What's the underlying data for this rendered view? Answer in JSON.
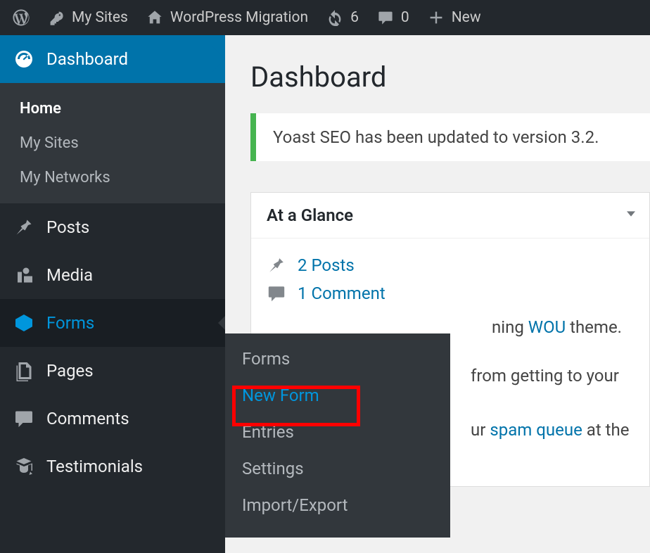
{
  "adminbar": {
    "my_sites": "My Sites",
    "site_title": "WordPress Migration",
    "updates_count": "6",
    "comments_count": "0",
    "new_label": "New"
  },
  "sidebar": {
    "dashboard": {
      "label": "Dashboard",
      "submenu": {
        "home": "Home",
        "my_sites": "My Sites",
        "my_networks": "My Networks"
      }
    },
    "posts": "Posts",
    "media": "Media",
    "forms": {
      "label": "Forms",
      "submenu": {
        "forms": "Forms",
        "new_form": "New Form",
        "entries": "Entries",
        "settings": "Settings",
        "import_export": "Import/Export"
      }
    },
    "pages": "Pages",
    "comments": "Comments",
    "testimonials": "Testimonials"
  },
  "content": {
    "title": "Dashboard",
    "notice": "Yoast SEO has been updated to version 3.2.",
    "glance": {
      "header": "At a Glance",
      "posts": "2 Posts",
      "comments": "1 Comment",
      "theme_prefix": "ning ",
      "theme_name": "WOU",
      "theme_suffix": " theme.",
      "spam_line1": " from getting to your bl",
      "spam_link": "spam queue",
      "spam_line2_prefix": "ur ",
      "spam_line2_suffix": " at the m"
    }
  }
}
